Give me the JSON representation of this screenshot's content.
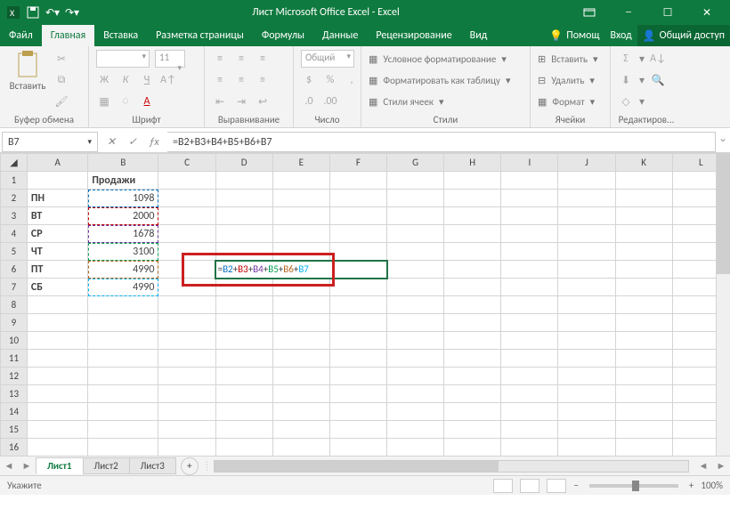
{
  "title": "Лист Microsoft Office Excel - Excel",
  "tabs": {
    "file": "Файл",
    "home": "Главная",
    "insert": "Вставка",
    "layout": "Разметка страницы",
    "formulas": "Формулы",
    "data": "Данные",
    "review": "Рецензирование",
    "view": "Вид",
    "help": "Помощ",
    "login": "Вход",
    "share": "Общий доступ"
  },
  "ribbon": {
    "clipboard": {
      "paste": "Вставить",
      "label": "Буфер обмена"
    },
    "font": {
      "size": "11",
      "label": "Шрифт"
    },
    "alignment": {
      "label": "Выравнивание"
    },
    "number": {
      "format": "Общий",
      "label": "Число"
    },
    "styles": {
      "cond": "Условное форматирование",
      "table": "Форматировать как таблицу",
      "cell": "Стили ячеек",
      "label": "Стили"
    },
    "cells": {
      "insert": "Вставить",
      "delete": "Удалить",
      "format": "Формат",
      "label": "Ячейки"
    },
    "editing": {
      "label": "Редактиров..."
    }
  },
  "namebox": "B7",
  "formula": "=B2+B3+B4+B5+B6+B7",
  "columns": [
    "A",
    "B",
    "C",
    "D",
    "E",
    "F",
    "G",
    "H",
    "I",
    "J",
    "K",
    "L"
  ],
  "rows": [
    1,
    2,
    3,
    4,
    5,
    6,
    7,
    8,
    9,
    10,
    11,
    12,
    13,
    14,
    15,
    16
  ],
  "data": {
    "B1": "Продажи",
    "A2": "ПН",
    "B2": "1098",
    "A3": "ВТ",
    "B3": "2000",
    "A4": "СР",
    "B4": "1678",
    "A5": "ЧТ",
    "B5": "3100",
    "A6": "ПТ",
    "B6": "4990",
    "A7": "СБ",
    "B7": "4990"
  },
  "formula_parts": {
    "eq": "=",
    "b2": "B2",
    "b3": "B3",
    "b4": "B4",
    "b5": "B5",
    "b6": "B6",
    "b7": "B7",
    "plus": "+"
  },
  "ref_colors": {
    "B2": "#0070c0",
    "B3": "#c00000",
    "B4": "#7030a0",
    "B5": "#00a050",
    "B6": "#b5651d",
    "B7": "#00b0f0"
  },
  "sheets": [
    "Лист1",
    "Лист2",
    "Лист3"
  ],
  "status": {
    "mode": "Укажите",
    "zoom": "100%"
  }
}
